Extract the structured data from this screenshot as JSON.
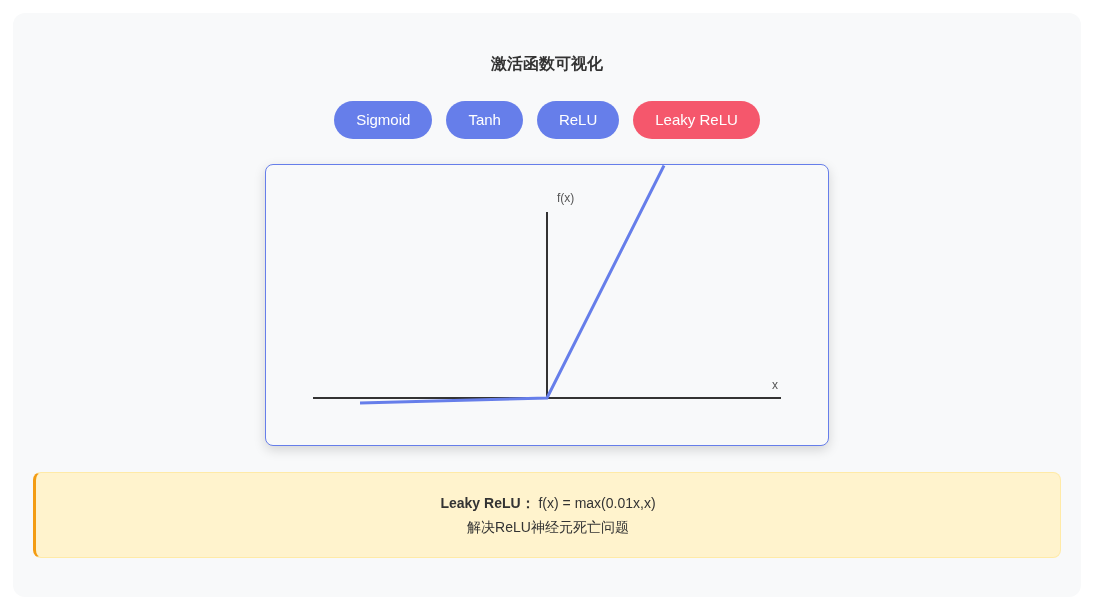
{
  "title": "激活函数可视化",
  "buttons": [
    {
      "label": "Sigmoid",
      "selected": false
    },
    {
      "label": "Tanh",
      "selected": false
    },
    {
      "label": "ReLU",
      "selected": false
    },
    {
      "label": "Leaky ReLU",
      "selected": true
    }
  ],
  "plot": {
    "y_axis_label": "f(x)",
    "x_axis_label": "x"
  },
  "info": {
    "formula": "**Leaky ReLU：** f(x) = max(0.01x,x)",
    "description": "解决ReLU神经元死亡问题"
  }
}
